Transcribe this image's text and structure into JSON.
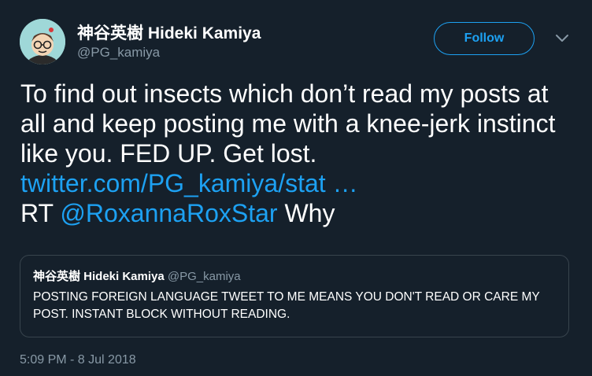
{
  "author": {
    "display_name": "神谷英樹 Hideki Kamiya",
    "handle": "@PG_kamiya",
    "avatar_icon": "cartoon-avatar-icon"
  },
  "follow_button": {
    "label": "Follow"
  },
  "menu": {
    "icon": "chevron-down-icon"
  },
  "tweet": {
    "line1": "To find out insects which don’t read my posts at all and keep posting me with a knee-jerk instinct like you. FED UP. Get lost.",
    "link": "twitter.com/PG_kamiya/stat …",
    "rt_prefix": "RT",
    "mention": "@RoxannaRoxStar",
    "rt_suffix": "Why"
  },
  "quoted_tweet": {
    "display_name": "神谷英樹 Hideki Kamiya",
    "handle": "@PG_kamiya",
    "text": "POSTING FOREIGN LANGUAGE TWEET TO ME MEANS YOU DON'T READ OR CARE MY POST. INSTANT BLOCK WITHOUT READING."
  },
  "timestamp": "5:09 PM - 8 Jul 2018",
  "colors": {
    "background": "#15202b",
    "accent": "#1da1f2",
    "secondary_text": "#8899a6",
    "border": "#38444d"
  }
}
